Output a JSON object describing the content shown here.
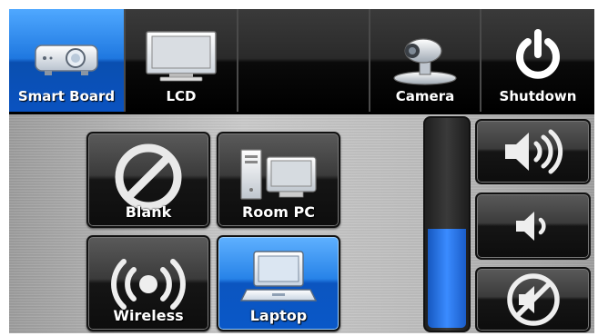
{
  "tabs": [
    {
      "label": "Smart Board",
      "icon": "projector-icon",
      "active": true
    },
    {
      "label": "LCD",
      "icon": "monitor-icon",
      "active": false
    },
    {
      "label": "",
      "icon": "",
      "active": false
    },
    {
      "label": "Camera",
      "icon": "camera-icon",
      "active": false
    },
    {
      "label": "Shutdown",
      "icon": "power-icon",
      "active": false
    }
  ],
  "sources": {
    "blank": {
      "label": "Blank",
      "icon": "blank-icon"
    },
    "room_pc": {
      "label": "Room PC",
      "icon": "desktop-pc-icon"
    },
    "wireless": {
      "label": "Wireless",
      "icon": "wireless-icon"
    },
    "laptop": {
      "label": "Laptop",
      "icon": "laptop-icon",
      "active": true
    }
  },
  "volume": {
    "level_fraction": 0.48,
    "up_icon": "volume-up-icon",
    "down_icon": "volume-down-icon",
    "mute_icon": "mute-icon"
  },
  "colors": {
    "active_blue": "#1f78e0",
    "button_dark": "#151515"
  }
}
